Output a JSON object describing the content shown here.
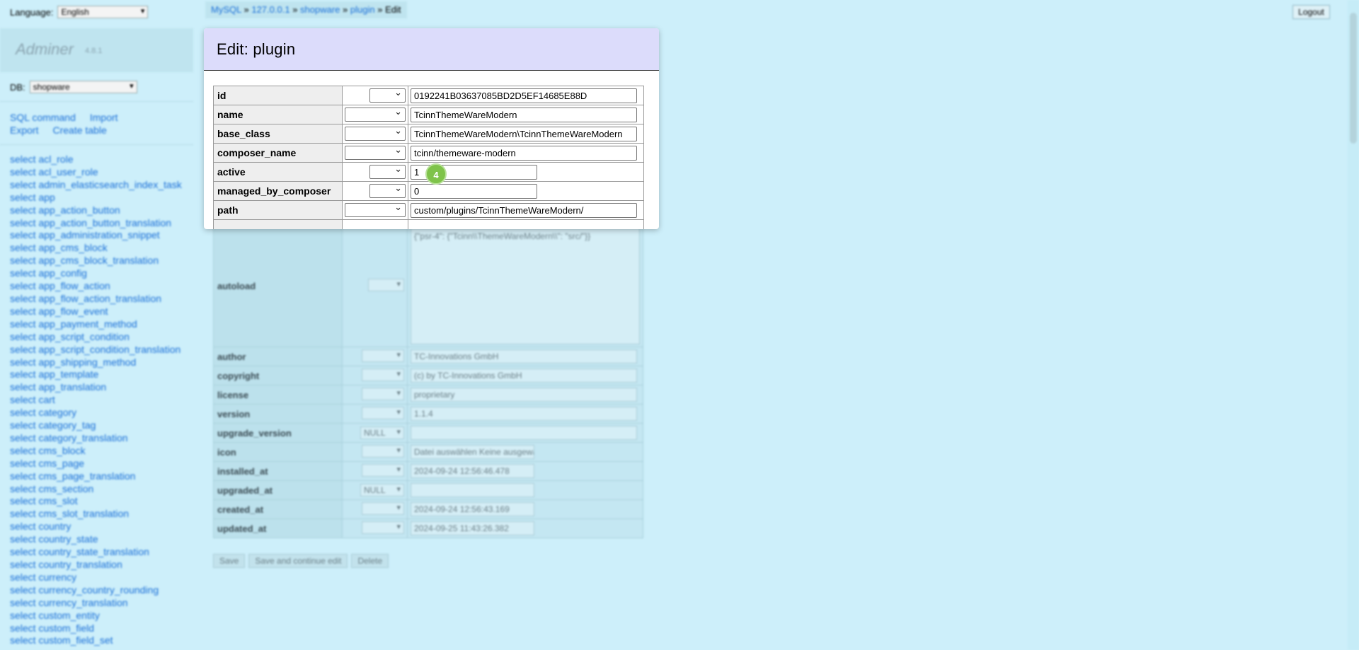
{
  "sidebar": {
    "language_label": "Language:",
    "language_value": "English",
    "logo": "Adminer",
    "version": "4.8.1",
    "db_label": "DB:",
    "db_value": "shopware",
    "links": [
      "SQL command",
      "Import",
      "Export",
      "Create table"
    ],
    "tables": [
      "select acl_role",
      "select acl_user_role",
      "select admin_elasticsearch_index_task",
      "select app",
      "select app_action_button",
      "select app_action_button_translation",
      "select app_administration_snippet",
      "select app_cms_block",
      "select app_cms_block_translation",
      "select app_config",
      "select app_flow_action",
      "select app_flow_action_translation",
      "select app_flow_event",
      "select app_payment_method",
      "select app_script_condition",
      "select app_script_condition_translation",
      "select app_shipping_method",
      "select app_template",
      "select app_translation",
      "select cart",
      "select category",
      "select category_tag",
      "select category_translation",
      "select cms_block",
      "select cms_page",
      "select cms_page_translation",
      "select cms_section",
      "select cms_slot",
      "select cms_slot_translation",
      "select country",
      "select country_state",
      "select country_state_translation",
      "select country_translation",
      "select currency",
      "select currency_country_rounding",
      "select currency_translation",
      "select custom_entity",
      "select custom_field",
      "select custom_field_set"
    ]
  },
  "breadcrumb": {
    "items": [
      "MySQL",
      "127.0.0.1",
      "shopware",
      "plugin"
    ],
    "separator": "»",
    "current": "Edit"
  },
  "header": {
    "logout": "Logout"
  },
  "panel": {
    "title": "Edit: plugin",
    "rows": [
      {
        "field": "id",
        "value": "0192241B03637085BD2D5EF14685E88D"
      },
      {
        "field": "name",
        "value": "TcinnThemeWareModern"
      },
      {
        "field": "base_class",
        "value": "TcinnThemeWareModern\\TcinnThemeWareModern"
      },
      {
        "field": "composer_name",
        "value": "tcinn/themeware-modern"
      },
      {
        "field": "active",
        "value": "1"
      },
      {
        "field": "managed_by_composer",
        "value": "0"
      },
      {
        "field": "path",
        "value": "custom/plugins/TcinnThemeWareModern/"
      }
    ],
    "badge": "4"
  },
  "background_form": {
    "autoload_label": "autoload",
    "autoload_value": "{\"psr-4\": {\"Tcinn\\\\ThemeWareModern\\\\\": \"src/\"}}",
    "rows": [
      {
        "field": "author",
        "fn": "",
        "value": "TC-Innovations GmbH"
      },
      {
        "field": "copyright",
        "fn": "",
        "value": "(c) by TC-Innovations GmbH"
      },
      {
        "field": "license",
        "fn": "",
        "value": "proprietary"
      },
      {
        "field": "version",
        "fn": "",
        "value": "1.1.4"
      },
      {
        "field": "upgrade_version",
        "fn": "NULL",
        "value": ""
      },
      {
        "field": "icon",
        "fn": "",
        "value": "Datei auswählen   Keine ausgewählt"
      },
      {
        "field": "installed_at",
        "fn": "",
        "value": "2024-09-24 12:56:46.478"
      },
      {
        "field": "upgraded_at",
        "fn": "NULL",
        "value": ""
      },
      {
        "field": "created_at",
        "fn": "",
        "value": "2024-09-24 12:56:43.169"
      },
      {
        "field": "updated_at",
        "fn": "",
        "value": "2024-09-25 11:43:26.382"
      }
    ],
    "buttons": [
      "Save",
      "Save and continue edit",
      "Delete"
    ]
  },
  "colors": {
    "page_bg": "#cdeffa",
    "panel_header": "#dcdcfb",
    "badge": "#7fc34a",
    "link": "#1a6fd8"
  }
}
